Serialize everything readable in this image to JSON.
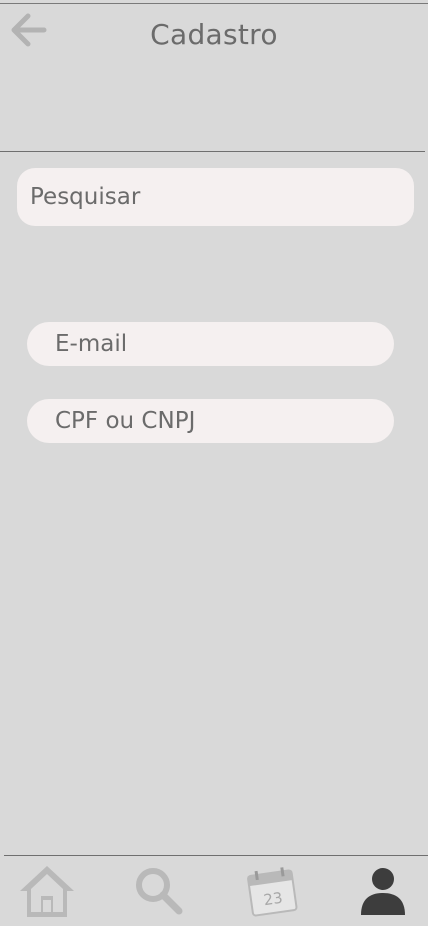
{
  "header": {
    "title": "Cadastro"
  },
  "search": {
    "placeholder": "Pesquisar"
  },
  "form": {
    "email_placeholder": "E-mail",
    "document_placeholder": "CPF ou CNPJ"
  },
  "bottom_nav": {
    "items": [
      {
        "icon": "home-icon",
        "active": false
      },
      {
        "icon": "search-icon",
        "active": false
      },
      {
        "icon": "calendar-icon",
        "active": false
      },
      {
        "icon": "profile-icon",
        "active": true
      }
    ],
    "calendar_day": "23"
  },
  "colors": {
    "background": "#d9d9d9",
    "field": "#f5f0f0",
    "text": "#6b6b6b",
    "inactive_icon": "#b9b9b9",
    "active_icon": "#3d3d3d"
  }
}
